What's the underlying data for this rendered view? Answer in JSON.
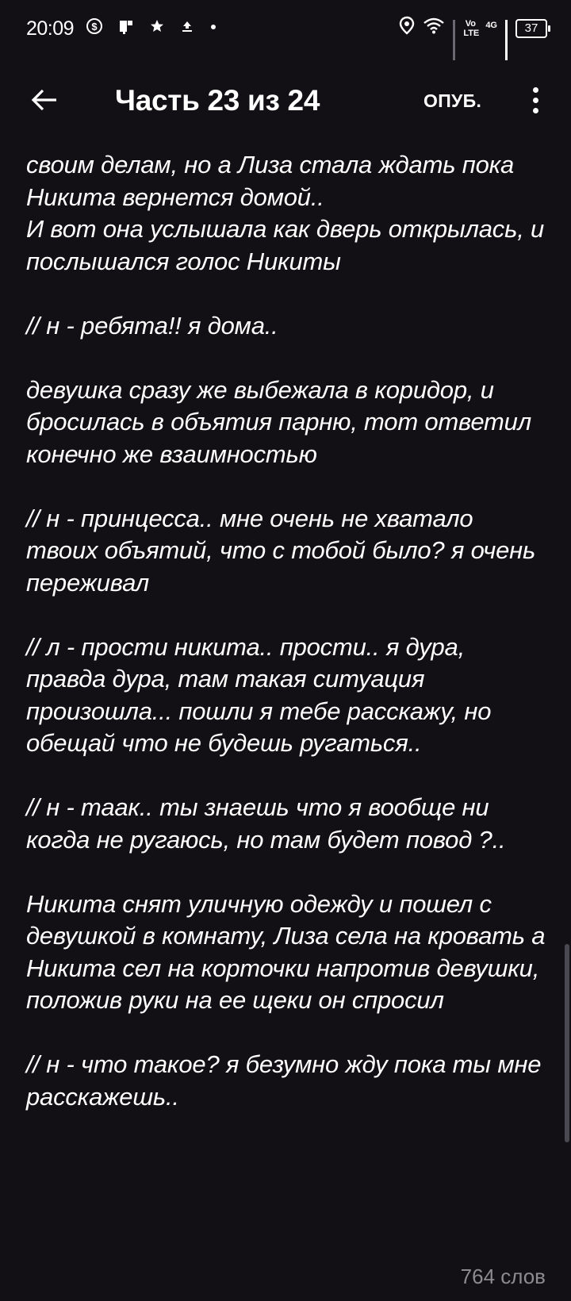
{
  "status_bar": {
    "time": "20:09",
    "battery": "37",
    "network": "4G",
    "volte": "Vo LTE"
  },
  "toolbar": {
    "title": "Часть 23 из 24",
    "publish_label": "ОПУБ."
  },
  "story": {
    "paragraphs": [
      "своим делам, но а Лиза стала ждать пока Никита вернется домой..\nИ вот она услышала как дверь открылась, и послышался голос Никиты",
      "// н - ребята!! я дома..",
      "девушка сразу же выбежала в коридор, и бросилась в объятия парню, тот ответил конечно же взаимностью",
      "// н - принцесса.. мне очень не хватало твоих объятий, что с тобой было? я очень переживал",
      "// л - прости никита.. прости.. я дура, правда дура, там такая ситуация произошла... пошли я тебе расскажу, но обещай что не будешь ругаться..",
      "// н - таак.. ты знаешь что я вообще ни когда не ругаюсь, но там будет повод ?..",
      "Никита снят уличную одежду и пошел с девушкой в комнату, Лиза села на кровать а Никита сел на корточки напротив девушки, положив руки на ее щеки он спросил",
      "// н - что такое? я безумно жду пока ты мне расскажешь.."
    ]
  },
  "footer": {
    "word_count": "764 слов"
  }
}
